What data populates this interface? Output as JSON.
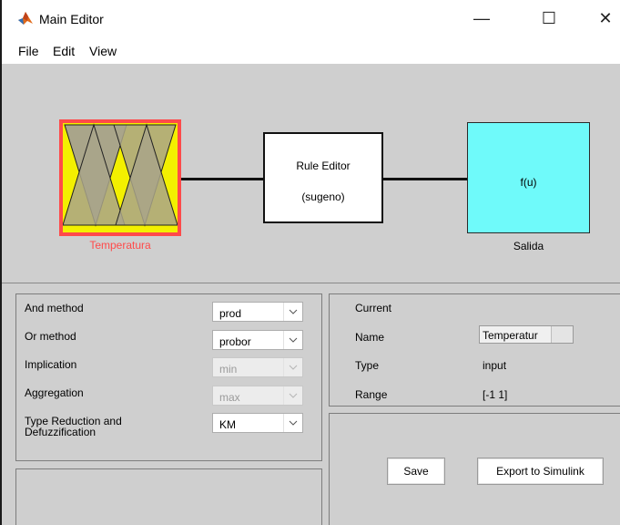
{
  "window": {
    "title": "Main Editor",
    "minimize_symbol": "—",
    "maximize_symbol": "☐",
    "close_symbol": "✕"
  },
  "menu": [
    "File",
    "Edit",
    "View"
  ],
  "diagram": {
    "input": {
      "name": "Temperatura",
      "color": "#f3f000",
      "border_color": "#ff4a4a"
    },
    "rules": {
      "line1": "Rule Editor",
      "line2": "(sugeno)"
    },
    "output": {
      "name": "Salida",
      "function": "f(u)",
      "color": "#6ffafa"
    }
  },
  "methods": {
    "and_method": {
      "label": "And method",
      "value": "prod",
      "enabled": true
    },
    "or_method": {
      "label": "Or method",
      "value": "probor",
      "enabled": true
    },
    "implication": {
      "label": "Implication",
      "value": "min",
      "enabled": false
    },
    "aggregation": {
      "label": "Aggregation",
      "value": "max",
      "enabled": false
    },
    "type_reduction": {
      "label_line1": "Type Reduction and",
      "label_line2": "Defuzzification",
      "value": "KM",
      "enabled": true
    }
  },
  "current": {
    "heading": "Current",
    "name_label": "Name",
    "name_value": "Temperatur",
    "type_label": "Type",
    "type_value": "input",
    "range_label": "Range",
    "range_value": "[-1 1]"
  },
  "actions": {
    "save_label": "Save",
    "export_label": "Export to Simulink"
  },
  "icons": {
    "app": "matlab-icon",
    "dropdown": "chevron-down-icon"
  }
}
